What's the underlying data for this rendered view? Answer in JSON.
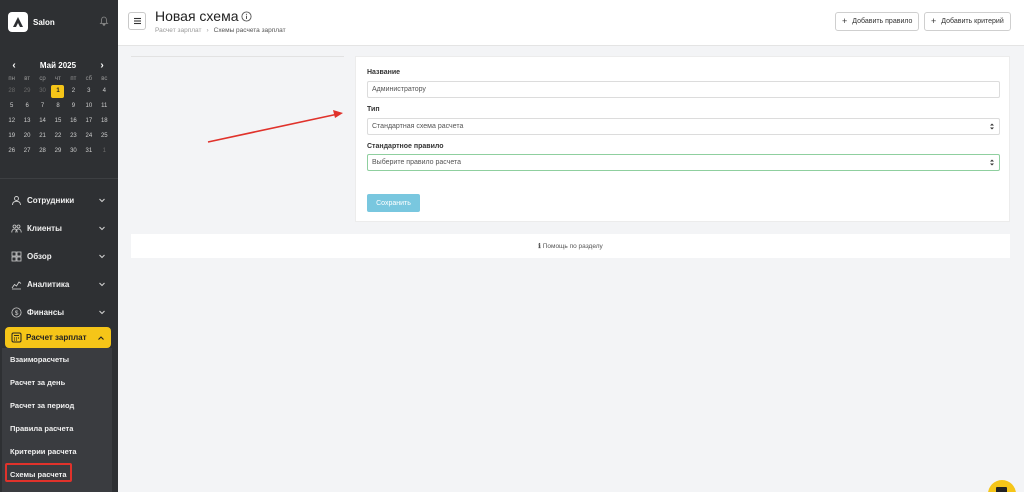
{
  "brand": {
    "name": "Salon"
  },
  "calendar": {
    "month": "Май 2025",
    "weekdays": [
      "пн",
      "вт",
      "ср",
      "чт",
      "пт",
      "сб",
      "вс"
    ],
    "weeks": [
      [
        "28",
        "29",
        "30",
        "1",
        "2",
        "3",
        "4"
      ],
      [
        "5",
        "6",
        "7",
        "8",
        "9",
        "10",
        "11"
      ],
      [
        "12",
        "13",
        "14",
        "15",
        "16",
        "17",
        "18"
      ],
      [
        "19",
        "20",
        "21",
        "22",
        "23",
        "24",
        "25"
      ],
      [
        "26",
        "27",
        "28",
        "29",
        "30",
        "31",
        "1"
      ]
    ],
    "today": "1"
  },
  "nav": {
    "items": [
      {
        "label": "Сотрудники",
        "icon": "user-icon"
      },
      {
        "label": "Клиенты",
        "icon": "users-icon"
      },
      {
        "label": "Обзор",
        "icon": "grid-icon"
      },
      {
        "label": "Аналитика",
        "icon": "chart-icon"
      },
      {
        "label": "Финансы",
        "icon": "dollar-icon"
      }
    ],
    "active": {
      "label": "Расчет зарплат",
      "icon": "calculator-icon"
    },
    "sub_items": [
      "Взаиморасчеты",
      "Расчет за день",
      "Расчет за период",
      "Правила расчета",
      "Критерии расчета",
      "Схемы расчета"
    ]
  },
  "header": {
    "title": "Новая схема",
    "breadcrumb": {
      "parent": "Расчет зарплат",
      "current": "Схемы расчета зарплат"
    },
    "add_rule_label": "Добавить правило",
    "add_criterion_label": "Добавить критерий"
  },
  "form": {
    "name_label": "Название",
    "name_value": "Администратору",
    "type_label": "Тип",
    "type_value": "Стандартная схема расчета",
    "rule_label": "Стандартное правило",
    "rule_value": "Выберите правило расчета",
    "save_label": "Сохранить"
  },
  "help": {
    "label": "Помощь по разделу"
  },
  "colors": {
    "accent": "#f5c518",
    "sidebar": "#2e3033",
    "save": "#79c7df",
    "annotation": "#e0322b"
  }
}
